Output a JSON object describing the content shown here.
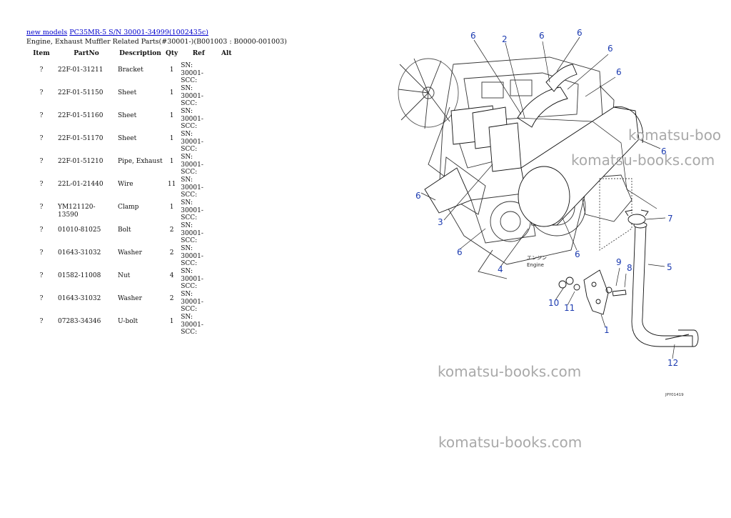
{
  "breadcrumb": {
    "link1": "new models",
    "link2": "PC35MR-5 S/N 30001-34999(1002435c)"
  },
  "page_subtitle": "Engine, Exhaust Muffler Related Parts(#30001-)(B001003 : B0000-001003)",
  "table": {
    "headers": [
      "Item",
      "PartNo",
      "Description",
      "Qty",
      "Ref",
      "Alt"
    ],
    "rows": [
      {
        "item": "?",
        "part": "22F-01-31211",
        "desc": "Bracket",
        "qty": "1",
        "ref": "SN: 30001-SCC:"
      },
      {
        "item": "?",
        "part": "22F-01-51150",
        "desc": "Sheet",
        "qty": "1",
        "ref": "SN: 30001-SCC:"
      },
      {
        "item": "?",
        "part": "22F-01-51160",
        "desc": "Sheet",
        "qty": "1",
        "ref": "SN: 30001-SCC:"
      },
      {
        "item": "?",
        "part": "22F-01-51170",
        "desc": "Sheet",
        "qty": "1",
        "ref": "SN: 30001-SCC:"
      },
      {
        "item": "?",
        "part": "22F-01-51210",
        "desc": "Pipe, Exhaust",
        "qty": "1",
        "ref": "SN: 30001-SCC:"
      },
      {
        "item": "?",
        "part": "22L-01-21440",
        "desc": "Wire",
        "qty": "11",
        "ref": "SN: 30001-SCC:"
      },
      {
        "item": "?",
        "part": "YM121120-13590",
        "desc": "Clamp",
        "qty": "1",
        "ref": "SN: 30001-SCC:"
      },
      {
        "item": "?",
        "part": "01010-81025",
        "desc": "Bolt",
        "qty": "2",
        "ref": "SN: 30001-SCC:"
      },
      {
        "item": "?",
        "part": "01643-31032",
        "desc": "Washer",
        "qty": "2",
        "ref": "SN: 30001-SCC:"
      },
      {
        "item": "?",
        "part": "01582-11008",
        "desc": "Nut",
        "qty": "4",
        "ref": "SN: 30001-SCC:"
      },
      {
        "item": "?",
        "part": "01643-31032",
        "desc": "Washer",
        "qty": "2",
        "ref": "SN: 30001-SCC:"
      },
      {
        "item": "?",
        "part": "07283-34346",
        "desc": "U-bolt",
        "qty": "1",
        "ref": "SN: 30001-SCC:"
      }
    ]
  },
  "diagram": {
    "callouts": [
      "6",
      "2",
      "6",
      "6",
      "6",
      "6",
      "6",
      "6",
      "3",
      "6",
      "4",
      "6",
      "7",
      "9",
      "8",
      "5",
      "10",
      "11",
      "1",
      "12"
    ],
    "engine_label_jp": "エンジン",
    "engine_label_en": "Engine",
    "drawing_code": "JPY01419"
  },
  "watermarks": [
    "komatsu-boo",
    "komatsu-books.com",
    "komatsu-books.com",
    "komatsu-books.com"
  ]
}
